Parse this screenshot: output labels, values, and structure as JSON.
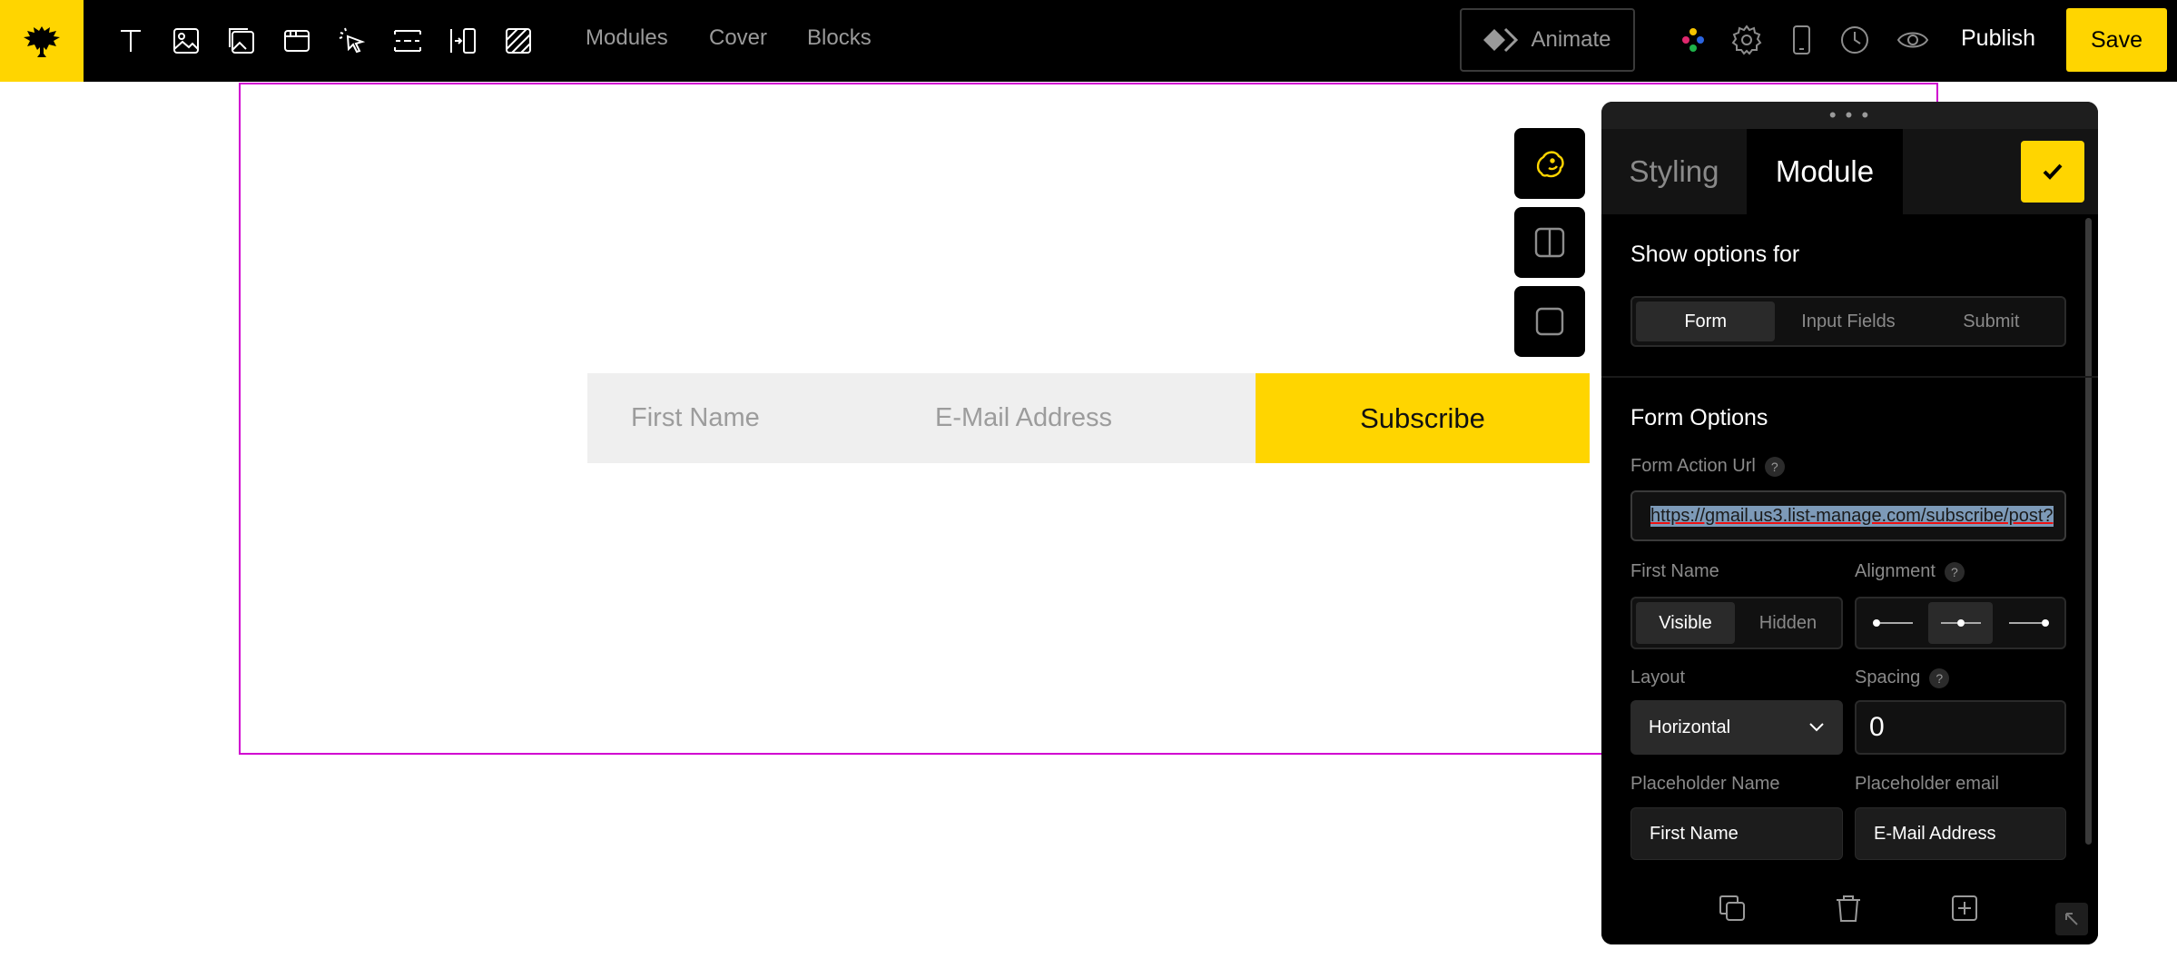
{
  "toolbar": {
    "tools": [
      "text-tool-icon",
      "image-tool-icon",
      "gallery-tool-icon",
      "window-tool-icon",
      "pointer-tool-icon",
      "spacer-tool-icon",
      "column-tool-icon",
      "pattern-tool-icon"
    ],
    "nav": {
      "modules": "Modules",
      "cover": "Cover",
      "blocks": "Blocks"
    },
    "animate": "Animate",
    "publish": "Publish",
    "save": "Save"
  },
  "canvas": {
    "placeholder_first": "First Name",
    "placeholder_email": "E-Mail Address",
    "subscribe": "Subscribe"
  },
  "panel": {
    "handle": "• • •",
    "tabs": {
      "styling": "Styling",
      "module": "Module"
    },
    "show_options_for": "Show options for",
    "options_for": [
      "Form",
      "Input Fields",
      "Submit"
    ],
    "form_options": "Form Options",
    "form_action_url_label": "Form Action Url",
    "form_action_url": "https://gmail.us3.list-manage.com/subscribe/post?",
    "first_name_label": "First Name",
    "first_name_options": [
      "Visible",
      "Hidden"
    ],
    "alignment_label": "Alignment",
    "layout_label": "Layout",
    "layout_value": "Horizontal",
    "spacing_label": "Spacing",
    "spacing_value": "0",
    "placeholder_name_label": "Placeholder Name",
    "placeholder_name_value": "First Name",
    "placeholder_email_label": "Placeholder email",
    "placeholder_email_value": "E-Mail Address",
    "help": "?"
  },
  "colors": {
    "accent": "#ffd500",
    "frame": "#d000d0",
    "bar": "#000000"
  }
}
